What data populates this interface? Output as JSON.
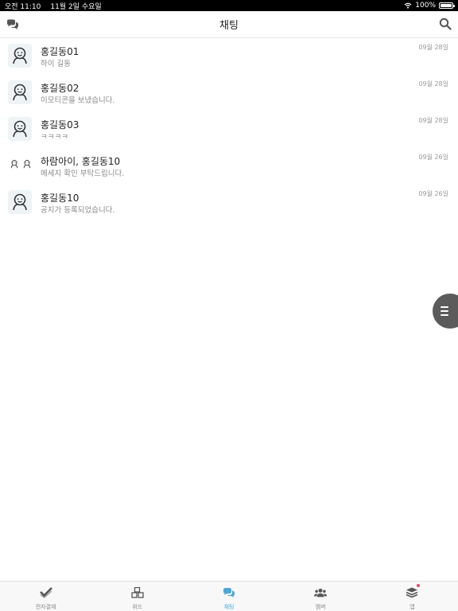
{
  "status_bar": {
    "time": "오전 11:10",
    "date": "11월 2일 수요일",
    "battery": "100%"
  },
  "header": {
    "title": "채팅"
  },
  "chats": [
    {
      "name": "홍길동01",
      "preview": "하이 길동",
      "date": "09월 28일",
      "avatar": "single"
    },
    {
      "name": "홍길동02",
      "preview": "이모티콘을 보냈습니다.",
      "date": "09월 28일",
      "avatar": "single"
    },
    {
      "name": "홍길동03",
      "preview": "ㅋㅋㅋㅋ",
      "date": "09월 28일",
      "avatar": "single"
    },
    {
      "name": "하람아이, 홍길동10",
      "preview": "메세지 확인 부탁드립니다.",
      "date": "09월 26일",
      "avatar": "group"
    },
    {
      "name": "홍길동10",
      "preview": "공지가 등록되었습니다.",
      "date": "09월 26일",
      "avatar": "single"
    }
  ],
  "tabs": [
    {
      "label": "전자결재",
      "icon": "approval-check-icon"
    },
    {
      "label": "위드",
      "icon": "boxes-icon"
    },
    {
      "label": "채팅",
      "icon": "chat-bubbles-icon",
      "active": true
    },
    {
      "label": "멤버",
      "icon": "members-icon"
    },
    {
      "label": "앱",
      "icon": "layers-icon",
      "badge": true
    }
  ],
  "colors": {
    "active_tab": "#4aa8d8",
    "badge": "#e74c6c",
    "floating_button": "#5b5b5b"
  }
}
